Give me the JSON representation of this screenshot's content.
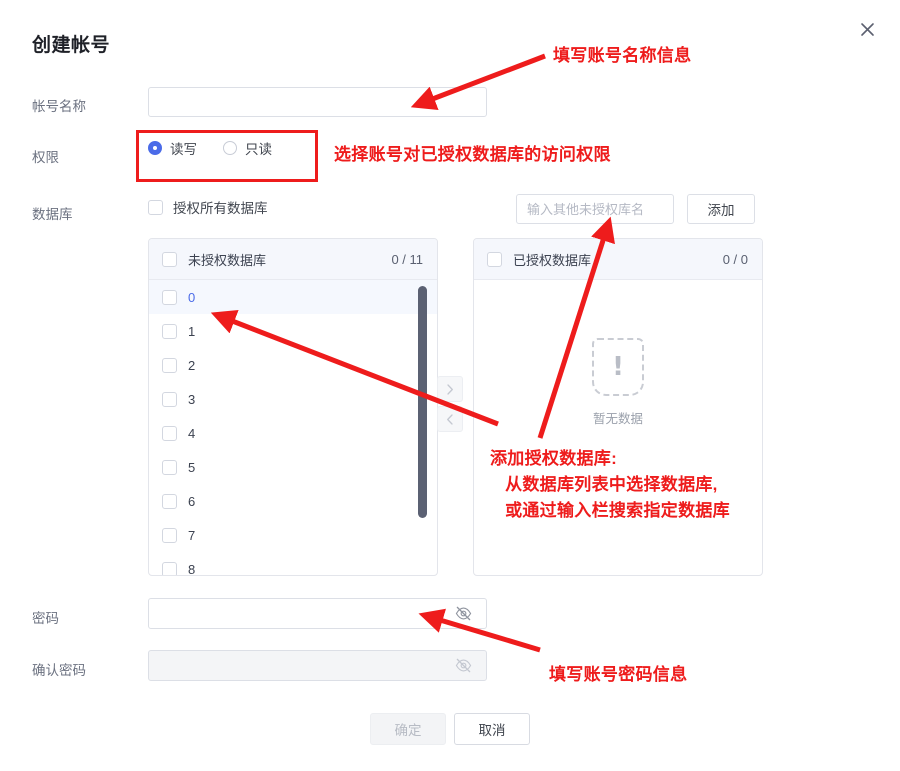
{
  "dialog": {
    "title": "创建帐号",
    "close_icon": "close-icon"
  },
  "fields": {
    "account_name": {
      "label": "帐号名称",
      "value": "",
      "placeholder": ""
    },
    "permission": {
      "label": "权限",
      "options": [
        {
          "label": "读写",
          "selected": true
        },
        {
          "label": "只读",
          "selected": false
        }
      ]
    },
    "database": {
      "label": "数据库",
      "grant_all_label": "授权所有数据库",
      "grant_all_checked": false,
      "search_placeholder": "输入其他未授权库名",
      "search_value": "",
      "add_button": "添加"
    },
    "password": {
      "label": "密码",
      "value": "",
      "placeholder": "",
      "eye_icon": "eye-off-icon"
    },
    "confirm_password": {
      "label": "确认密码",
      "value": "",
      "placeholder": "",
      "disabled": true,
      "eye_icon": "eye-off-icon"
    }
  },
  "transfer": {
    "left": {
      "title": "未授权数据库",
      "count": "0 / 11",
      "header_checked": false,
      "items": [
        {
          "label": "0",
          "active": true
        },
        {
          "label": "1",
          "active": false
        },
        {
          "label": "2",
          "active": false
        },
        {
          "label": "3",
          "active": false
        },
        {
          "label": "4",
          "active": false
        },
        {
          "label": "5",
          "active": false
        },
        {
          "label": "6",
          "active": false
        },
        {
          "label": "7",
          "active": false
        },
        {
          "label": "8",
          "active": false
        }
      ]
    },
    "right": {
      "title": "已授权数据库",
      "count": "0 / 0",
      "header_checked": false,
      "empty_text": "暂无数据",
      "empty_icon": "empty-box-icon"
    },
    "move_right_icon": "chevron-right-icon",
    "move_left_icon": "chevron-left-icon"
  },
  "footer": {
    "confirm_label": "确定",
    "cancel_label": "取消"
  },
  "annotations": {
    "accent_color": "#ee1c1c",
    "account_name": "填写账号名称信息",
    "permission": "选择账号对已授权数据库的访问权限",
    "database": "添加授权数据库:\n   从数据库列表中选择数据库,\n   或通过输入栏搜索指定数据库",
    "password": "填写账号密码信息"
  }
}
